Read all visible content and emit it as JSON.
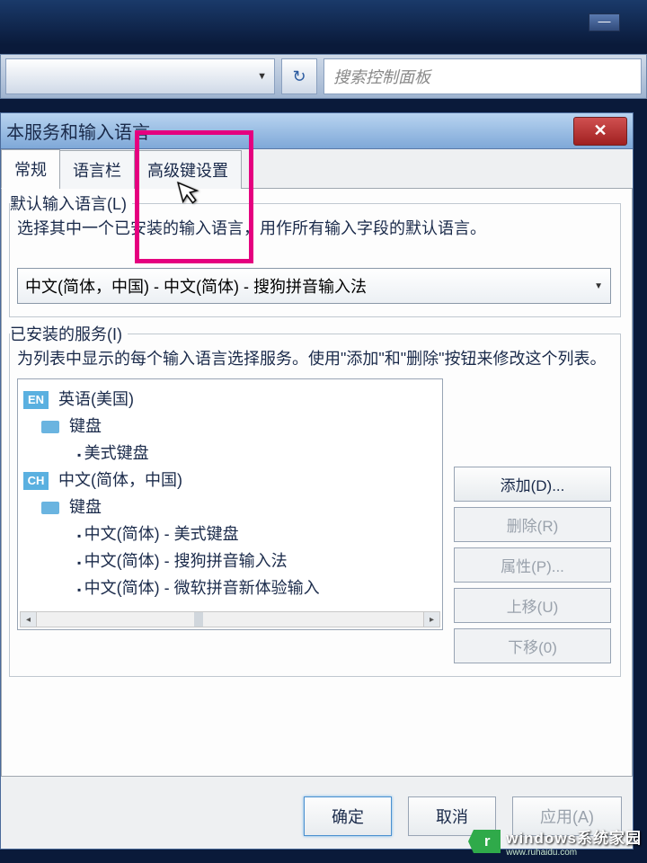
{
  "toolbar": {
    "search_placeholder": "搜索控制面板"
  },
  "dialog": {
    "title": "本服务和输入语言",
    "tabs": [
      "常规",
      "语言栏",
      "高级键设置"
    ],
    "default_lang": {
      "title": "默认输入语言(L)",
      "desc": "选择其中一个已安装的输入语言，用作所有输入字段的默认语言。",
      "selected": "中文(简体，中国) - 中文(简体) - 搜狗拼音输入法"
    },
    "services": {
      "title": "已安装的服务(I)",
      "desc": "为列表中显示的每个输入语言选择服务。使用\"添加\"和\"删除\"按钮来修改这个列表。",
      "tree": {
        "en": {
          "badge": "EN",
          "label": "英语(美国)",
          "keyboard_label": "键盘",
          "items": [
            "美式键盘"
          ]
        },
        "ch": {
          "badge": "CH",
          "label": "中文(简体，中国)",
          "keyboard_label": "键盘",
          "items": [
            "中文(简体) - 美式键盘",
            "中文(简体) - 搜狗拼音输入法",
            "中文(简体) - 微软拼音新体验输入"
          ]
        }
      },
      "buttons": {
        "add": "添加(D)...",
        "remove": "删除(R)",
        "properties": "属性(P)...",
        "moveup": "上移(U)",
        "movedown": "下移(0)"
      }
    },
    "footer": {
      "ok": "确定",
      "cancel": "取消",
      "apply": "应用(A)"
    }
  },
  "watermark": {
    "logo_letter": "r",
    "main": "windows系统家园",
    "sub": "www.ruhaidu.com"
  }
}
